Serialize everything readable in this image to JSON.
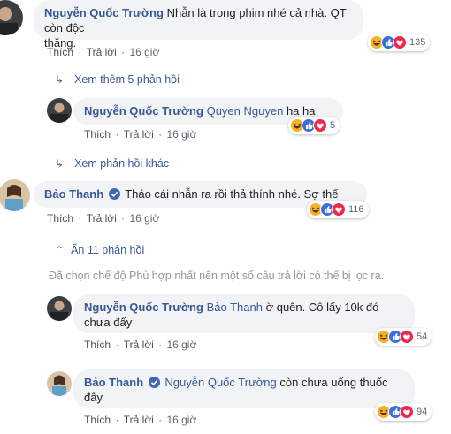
{
  "colors": {
    "link": "#385898",
    "bubble": "#f2f3f5",
    "meta": "#606770",
    "verified": "#4267b2"
  },
  "comments": [
    {
      "author": "Nguyễn Quốc Trường",
      "text_line1": "Nhẫn là trong phim nhé cả nhà. QT còn độc",
      "text_line2": "thăng.",
      "like": "Thích",
      "reply": "Trả lời",
      "time": "16 giờ",
      "reaction_count": "135",
      "reaction_icons": [
        "haha-icon",
        "like-icon",
        "love-icon"
      ]
    },
    {
      "view_more": "Xem thêm 5 phản hồi"
    },
    {
      "author": "Nguyễn Quốc Trường",
      "mention": "Quyen Nguyen",
      "text": "ha ha",
      "like": "Thích",
      "reply": "Trả lời",
      "time": "16 giờ",
      "reaction_count": "5"
    },
    {
      "view_other": "Xem phản hồi khác"
    },
    {
      "author": "Bảo Thanh",
      "text": "Tháo cái nhẫn ra rồi thả thính nhé. Sợ thế",
      "like": "Thích",
      "reply": "Trả lời",
      "time": "16 giờ",
      "reaction_count": "116"
    },
    {
      "hide_replies": "Ẩn 11 phản hồi",
      "filter_note": "Đã chọn chế độ Phù hợp nhất nên một số câu trả lời có thể bị lọc ra."
    },
    {
      "author": "Nguyễn Quốc Trường",
      "mention": "Bảo Thanh",
      "text_line1": "ờ quên. Cô lấy 10k đó",
      "text_line2": "chưa đấy",
      "like": "Thích",
      "reply": "Trả lời",
      "time": "16 giờ",
      "reaction_count": "54"
    },
    {
      "author": "Bảo Thanh",
      "mention": "Nguyễn Quốc Trường",
      "text_line1": "còn chưa uống thuốc",
      "text_line2": "đây",
      "like": "Thích",
      "reply": "Trả lời",
      "time": "16 giờ",
      "reaction_count": "94"
    }
  ]
}
